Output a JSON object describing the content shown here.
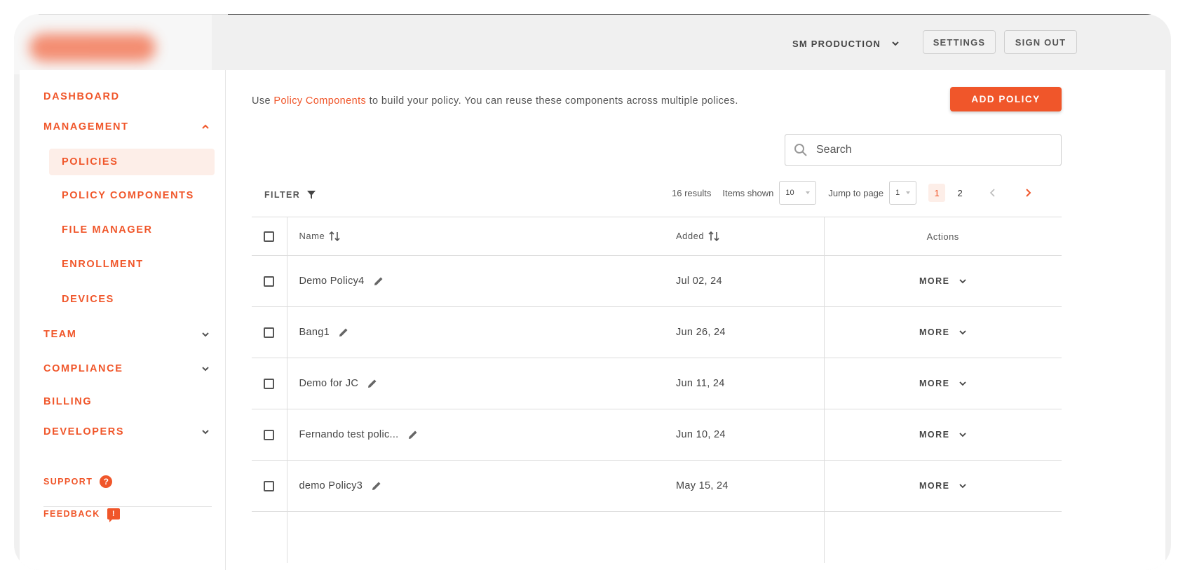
{
  "header": {
    "org_label": "SM PRODUCTION",
    "settings_label": "SETTINGS",
    "signout_label": "SIGN OUT"
  },
  "sidebar": {
    "dashboard": "DASHBOARD",
    "management": "MANAGEMENT",
    "sub_items": [
      "POLICIES",
      "POLICY COMPONENTS",
      "FILE MANAGER",
      "ENROLLMENT",
      "DEVICES"
    ],
    "team": "TEAM",
    "compliance": "COMPLIANCE",
    "billing": "BILLING",
    "developers": "DEVELOPERS",
    "support": "SUPPORT",
    "feedback": "FEEDBACK",
    "support_icon_glyph": "?",
    "feedback_icon_glyph": "!"
  },
  "main": {
    "intro_prefix": "Use ",
    "intro_link": "Policy Components",
    "intro_suffix": " to build your policy. You can reuse these components across multiple polices.",
    "add_policy_label": "ADD POLICY",
    "search_placeholder": "Search",
    "filter_label": "FILTER",
    "results": "16 results",
    "items_shown_label": "Items shown",
    "items_shown_value": "10",
    "jump_label": "Jump to page",
    "jump_value": "1",
    "pages": [
      "1",
      "2"
    ],
    "columns": {
      "name": "Name",
      "added": "Added",
      "actions": "Actions"
    },
    "more_label": "MORE",
    "rows": [
      {
        "name": "Demo Policy4",
        "added": "Jul 02, 24"
      },
      {
        "name": "Bang1",
        "added": "Jun 26, 24"
      },
      {
        "name": "Demo for JC",
        "added": "Jun 11, 24"
      },
      {
        "name": "Fernando test polic...",
        "added": "Jun 10, 24"
      },
      {
        "name": "demo Policy3",
        "added": "May 15, 24"
      }
    ]
  },
  "colors": {
    "accent": "#f0562a",
    "accent_light": "#fdeee8"
  }
}
